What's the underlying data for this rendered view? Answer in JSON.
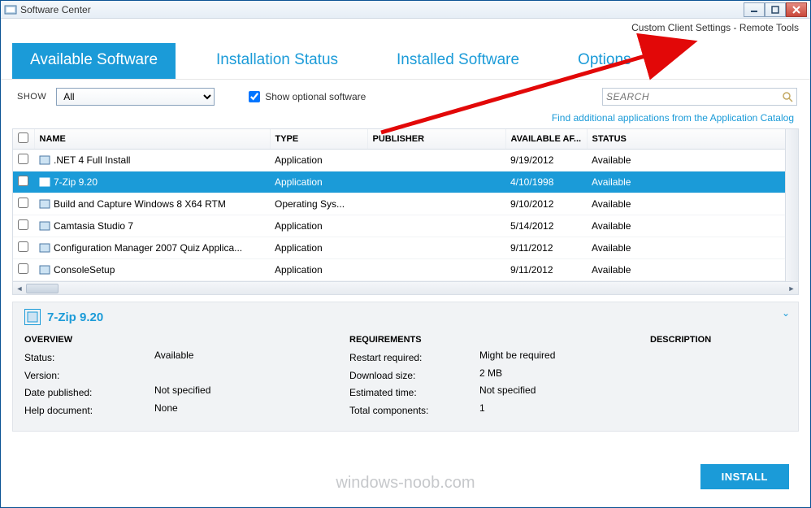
{
  "window": {
    "title": "Software Center",
    "subtitle": "Custom Client Settings - Remote Tools"
  },
  "tabs": [
    {
      "label": "Available Software",
      "active": true
    },
    {
      "label": "Installation Status",
      "active": false
    },
    {
      "label": "Installed Software",
      "active": false
    },
    {
      "label": "Options",
      "active": false
    }
  ],
  "filter": {
    "show_label": "SHOW",
    "select_value": "All",
    "optional_label": "Show optional software",
    "optional_checked": true,
    "search_placeholder": "SEARCH",
    "catalog_link": "Find additional applications from the Application Catalog"
  },
  "columns": {
    "name": "NAME",
    "type": "TYPE",
    "publisher": "PUBLISHER",
    "available": "AVAILABLE AF...",
    "status": "STATUS"
  },
  "rows": [
    {
      "name": ".NET 4 Full Install",
      "type": "Application",
      "publisher": "",
      "available": "9/19/2012",
      "status": "Available",
      "selected": false
    },
    {
      "name": "7-Zip 9.20",
      "type": "Application",
      "publisher": "",
      "available": "4/10/1998",
      "status": "Available",
      "selected": true
    },
    {
      "name": "Build and Capture Windows 8 X64 RTM",
      "type": "Operating Sys...",
      "publisher": "",
      "available": "9/10/2012",
      "status": "Available",
      "selected": false
    },
    {
      "name": "Camtasia Studio 7",
      "type": "Application",
      "publisher": "",
      "available": "5/14/2012",
      "status": "Available",
      "selected": false
    },
    {
      "name": "Configuration Manager 2007 Quiz Applica...",
      "type": "Application",
      "publisher": "",
      "available": "9/11/2012",
      "status": "Available",
      "selected": false
    },
    {
      "name": "ConsoleSetup",
      "type": "Application",
      "publisher": "",
      "available": "9/11/2012",
      "status": "Available",
      "selected": false
    }
  ],
  "details": {
    "title": "7-Zip 9.20",
    "overview_label": "OVERVIEW",
    "requirements_label": "REQUIREMENTS",
    "description_label": "DESCRIPTION",
    "overview": {
      "status_k": "Status:",
      "status_v": "Available",
      "version_k": "Version:",
      "version_v": "",
      "date_k": "Date published:",
      "date_v": "Not specified",
      "help_k": "Help document:",
      "help_v": "None"
    },
    "requirements": {
      "restart_k": "Restart required:",
      "restart_v": "Might be required",
      "download_k": "Download size:",
      "download_v": "2 MB",
      "time_k": "Estimated time:",
      "time_v": "Not specified",
      "components_k": "Total components:",
      "components_v": "1"
    }
  },
  "install_label": "INSTALL",
  "watermark": "windows-noob.com"
}
